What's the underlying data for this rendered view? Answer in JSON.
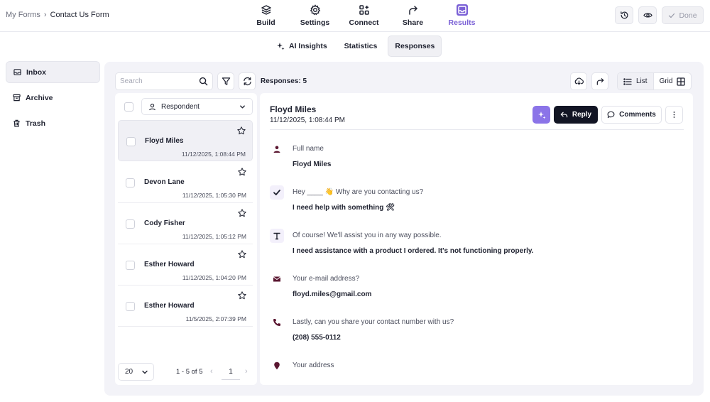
{
  "breadcrumb": {
    "root": "My Forms",
    "separator": "›",
    "current": "Contact Us Form"
  },
  "nav": [
    {
      "label": "Build",
      "icon": "layers-icon"
    },
    {
      "label": "Settings",
      "icon": "gear-icon"
    },
    {
      "label": "Connect",
      "icon": "integrations-icon"
    },
    {
      "label": "Share",
      "icon": "share-arrow-icon"
    },
    {
      "label": "Results",
      "icon": "inbox-icon",
      "active": true
    }
  ],
  "top_actions": {
    "done_label": "Done"
  },
  "subtabs": [
    {
      "label": "AI Insights",
      "icon": "sparkle-icon"
    },
    {
      "label": "Statistics"
    },
    {
      "label": "Responses",
      "active": true
    }
  ],
  "sidebar": [
    {
      "label": "Inbox",
      "icon": "inbox-icon",
      "active": true
    },
    {
      "label": "Archive",
      "icon": "archive-icon"
    },
    {
      "label": "Trash",
      "icon": "trash-icon"
    }
  ],
  "toolbar": {
    "search_placeholder": "Search",
    "responses_count": "Responses: 5",
    "view_list": "List",
    "view_grid": "Grid"
  },
  "list": {
    "sort_label": "Respondent",
    "entries": [
      {
        "name": "Floyd Miles",
        "date": "11/12/2025, 1:08:44 PM",
        "selected": true
      },
      {
        "name": "Devon Lane",
        "date": "11/12/2025, 1:05:30 PM"
      },
      {
        "name": "Cody Fisher",
        "date": "11/12/2025, 1:05:12 PM"
      },
      {
        "name": "Esther Howard",
        "date": "11/12/2025, 1:04:20 PM"
      },
      {
        "name": "Esther Howard",
        "date": "11/5/2025, 2:07:39 PM"
      }
    ],
    "pagination": {
      "per_page": "20",
      "range": "1 - 5 of 5",
      "page": "1",
      "prev": "‹",
      "next": "›"
    }
  },
  "detail": {
    "name": "Floyd Miles",
    "date": "11/12/2025, 1:08:44 PM",
    "reply_label": "Reply",
    "comments_label": "Comments",
    "fields": [
      {
        "icon": "person-icon",
        "question": "Full name",
        "answer": "Floyd Miles"
      },
      {
        "icon": "checkmark-icon",
        "question": "Hey ____ 👋 Why are you contacting us?",
        "answer": "I need help with something 🛠"
      },
      {
        "icon": "text-icon",
        "question": "Of course! We'll assist you in any way possible.",
        "answer": "I need assistance with a product I ordered. It's not functioning properly."
      },
      {
        "icon": "envelope-icon",
        "question": "Your e-mail address?",
        "answer": "floyd.miles@gmail.com"
      },
      {
        "icon": "phone-icon",
        "question": "Lastly, can you share your contact number with us?",
        "answer": "(208) 555-0112"
      },
      {
        "icon": "location-pin-icon",
        "question": "Your address",
        "answer": ""
      }
    ]
  },
  "colors": {
    "accent": "#7b61d6",
    "reply_bg": "#121524",
    "ai_button": "#8b74e8",
    "field_icon": "#5a1630"
  }
}
